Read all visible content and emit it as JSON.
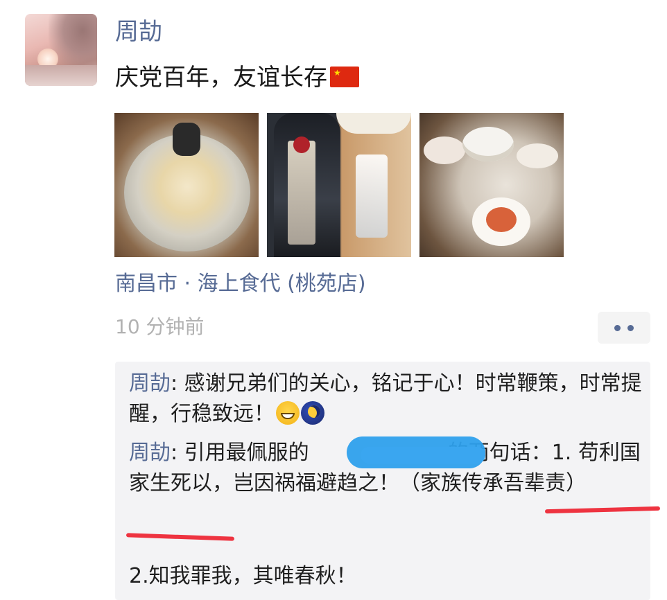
{
  "post": {
    "author": "周劼",
    "text": "庆党百年，友谊长存",
    "flag_icon": "china-flag-icon",
    "location": "南昌市 · 海上食代 (桃苑店)",
    "timestamp": "10 分钟前"
  },
  "photos": [
    {
      "icon": "food-pot-photo"
    },
    {
      "icon": "liquor-bottle-photo"
    },
    {
      "icon": "dining-table-photo"
    }
  ],
  "comments": [
    {
      "name": "周劼",
      "text": ": 感谢兄弟们的关心，铭记于心！时常鞭策，时常提醒，行稳致远！"
    },
    {
      "name": "周劼",
      "text_before": ": 引用最佩服的",
      "text_after": "的两句话：1. 苟利国家生死以，岂因祸福避趋之！（家族传承吾辈责）"
    },
    {
      "text": "2.知我罪我，其唯春秋！"
    }
  ],
  "colors": {
    "link": "#576b95",
    "annotation_red": "#ee3340",
    "redaction_blue": "#2ea0ec"
  }
}
